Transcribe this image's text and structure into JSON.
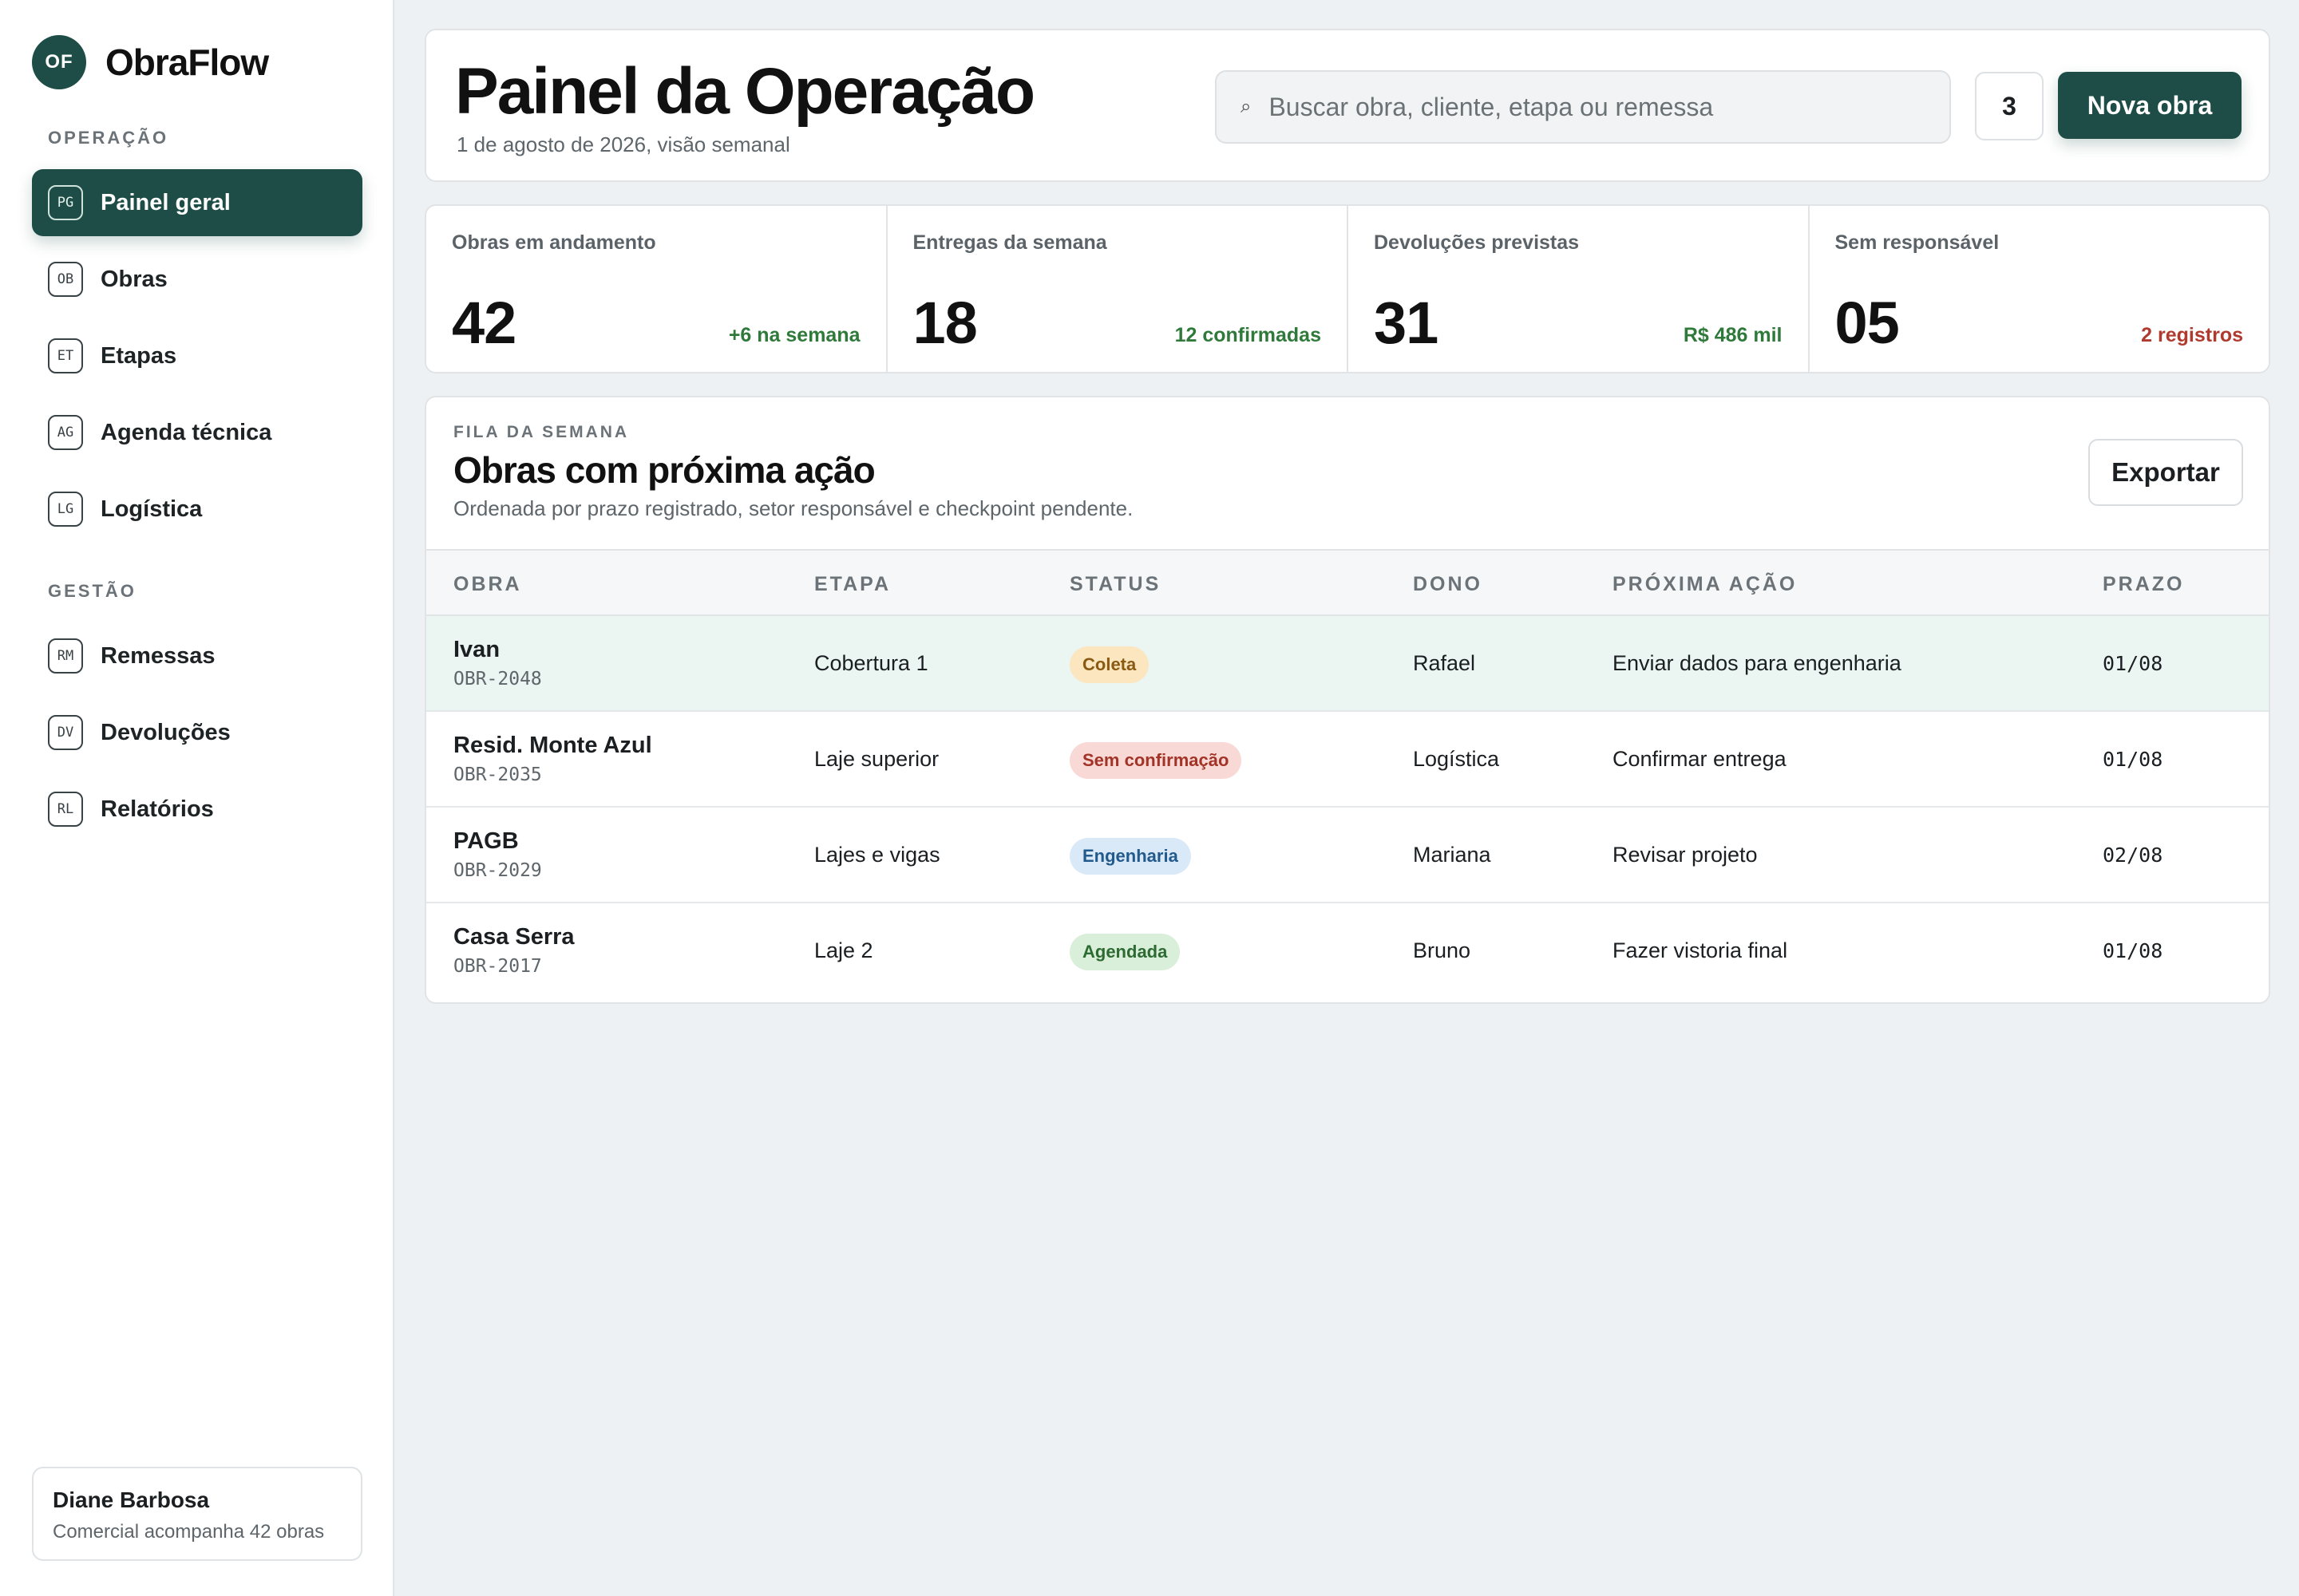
{
  "brand": {
    "logo": "OF",
    "name": "ObraFlow"
  },
  "sidebar": {
    "sections": [
      {
        "title": "OPERAÇÃO"
      },
      {
        "title": "GESTÃO"
      }
    ],
    "items": [
      {
        "code": "PG",
        "label": "Painel geral",
        "icon": "dashboard-icon"
      },
      {
        "code": "OB",
        "label": "Obras",
        "icon": "building-icon"
      },
      {
        "code": "ET",
        "label": "Etapas",
        "icon": "steps-icon"
      },
      {
        "code": "AG",
        "label": "Agenda técnica",
        "icon": "calendar-icon"
      },
      {
        "code": "LG",
        "label": "Logística",
        "icon": "truck-icon"
      },
      {
        "code": "RM",
        "label": "Remessas",
        "icon": "package-icon"
      },
      {
        "code": "DV",
        "label": "Devoluções",
        "icon": "return-icon"
      },
      {
        "code": "RL",
        "label": "Relatórios",
        "icon": "report-icon"
      }
    ],
    "active_item": "Painel geral"
  },
  "user": {
    "name": "Diane Barbosa",
    "subtitle": "Comercial acompanha 42 obras"
  },
  "header": {
    "title": "Painel da Operação",
    "subtitle": "1 de agosto de 2026, visão semanal",
    "search": {
      "placeholder": "Buscar obra, cliente, etapa ou remessa",
      "value": "",
      "icon": "search-icon"
    },
    "notification_count": "3",
    "primary_button": "Nova obra"
  },
  "kpis": [
    {
      "label": "Obras em andamento",
      "value": "42",
      "delta": "+6 na semana",
      "delta_color": "#2f7a3a"
    },
    {
      "label": "Entregas da semana",
      "value": "18",
      "delta": "12 confirmadas",
      "delta_color": "#2f7a3a"
    },
    {
      "label": "Devoluções previstas",
      "value": "31",
      "delta": "R$ 486 mil",
      "delta_color": "#2f7a3a"
    },
    {
      "label": "Sem responsável",
      "value": "05",
      "delta": "2 registros",
      "delta_color": "#b03a2e"
    }
  ],
  "queue": {
    "eyebrow": "FILA DA SEMANA",
    "title": "Obras com próxima ação",
    "subtitle": "Ordenada por prazo registrado, setor responsável e checkpoint pendente.",
    "export_label": "Exportar",
    "columns": [
      "OBRA",
      "ETAPA",
      "STATUS",
      "DONO",
      "PRÓXIMA AÇÃO",
      "PRAZO"
    ],
    "rows": [
      {
        "name": "Ivan",
        "code": "OBR-2048",
        "stage": "Cobertura 1",
        "status": "Coleta",
        "status_bg": "#fbe6bf",
        "status_fg": "#8a5a12",
        "owner": "Rafael",
        "next_action": "Enviar dados para engenharia",
        "deadline": "01/08",
        "highlight": true
      },
      {
        "name": "Resid. Monte Azul",
        "code": "OBR-2035",
        "stage": "Laje superior",
        "status": "Sem confirmação",
        "status_bg": "#f9d9d5",
        "status_fg": "#a23327",
        "owner": "Logística",
        "next_action": "Confirmar entrega",
        "deadline": "01/08",
        "highlight": false
      },
      {
        "name": "PAGB",
        "code": "OBR-2029",
        "stage": "Lajes e vigas",
        "status": "Engenharia",
        "status_bg": "#d9e9f8",
        "status_fg": "#235a8c",
        "owner": "Mariana",
        "next_action": "Revisar projeto",
        "deadline": "02/08",
        "highlight": false
      },
      {
        "name": "Casa Serra",
        "code": "OBR-2017",
        "stage": "Laje 2",
        "status": "Agendada",
        "status_bg": "#d9efd9",
        "status_fg": "#2d6b33",
        "owner": "Bruno",
        "next_action": "Fazer vistoria final",
        "deadline": "01/08",
        "highlight": false
      }
    ]
  }
}
